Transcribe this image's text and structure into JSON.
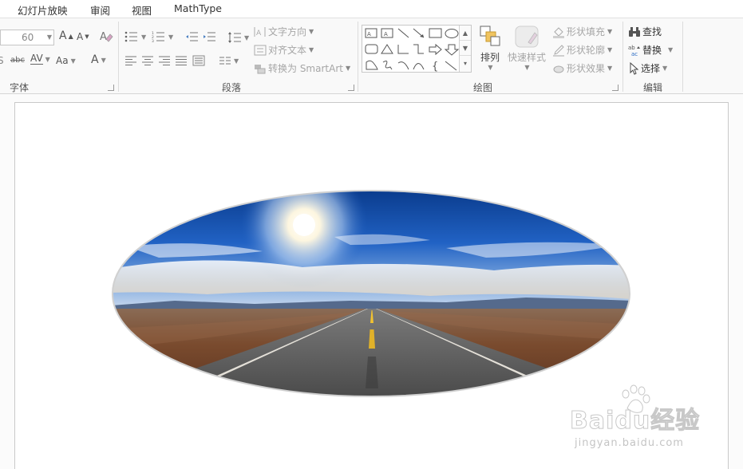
{
  "tabs": [
    {
      "label": "幻灯片放映"
    },
    {
      "label": "审阅"
    },
    {
      "label": "视图"
    },
    {
      "label": "MathType"
    }
  ],
  "ribbon": {
    "font": {
      "label": "字体",
      "size_value": "60",
      "increase_label": "A",
      "decrease_label": "A",
      "strike_label": "abc",
      "spacing_label": "AV",
      "case_label": "Aa",
      "color_label": "A",
      "shadow_label": "S"
    },
    "paragraph": {
      "label": "段落",
      "text_direction": "文字方向",
      "align_text": "对齐文本",
      "convert_smartart": "转换为 SmartArt"
    },
    "drawing": {
      "label": "绘图",
      "arrange": "排列",
      "quick_styles": "快速样式",
      "shape_fill": "形状填充",
      "shape_outline": "形状轮廓",
      "shape_effects": "形状效果"
    },
    "editing": {
      "label": "编辑",
      "find": "查找",
      "replace": "替换",
      "select": "选择"
    }
  },
  "watermark": {
    "brand": "Baidu经验",
    "url": "jingyan.baidu.com"
  },
  "colors": {
    "ribbon_bg": "#f9f9f9",
    "disabled_text": "#a6a6a6",
    "sky_top": "#0c3f8e",
    "road": "#555555",
    "ground": "#7a4b2e"
  }
}
